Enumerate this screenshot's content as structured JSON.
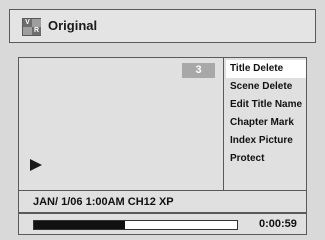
{
  "header": {
    "logo_letters": [
      "V",
      "R"
    ],
    "title": "Original"
  },
  "preview": {
    "title_number": "3"
  },
  "menu": {
    "items": [
      {
        "label": "Title Delete",
        "selected": true
      },
      {
        "label": "Scene Delete",
        "selected": false
      },
      {
        "label": "Edit Title Name",
        "selected": false
      },
      {
        "label": "Chapter Mark",
        "selected": false
      },
      {
        "label": "Index Picture",
        "selected": false
      },
      {
        "label": "Protect",
        "selected": false
      }
    ]
  },
  "status": {
    "info": "JAN/ 1/06 1:00AM CH12 XP"
  },
  "playback": {
    "progress": 0.45,
    "time": "0:00:59"
  },
  "colors": {
    "background": "#d9d9d9",
    "panel": "#e0e0e0",
    "selected": "#ffffff",
    "text": "#111111",
    "badge": "#a8a8a8"
  }
}
